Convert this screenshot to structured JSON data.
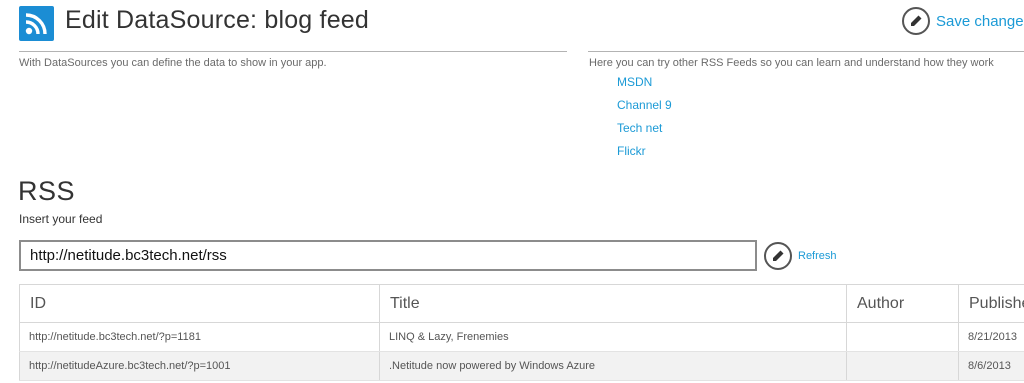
{
  "header": {
    "title": "Edit DataSource: blog feed",
    "logo_icon": "rss-icon",
    "save_label": "Save changes",
    "save_icon": "edit-pencil-icon",
    "accent_color": "#1b8dd4",
    "link_color": "#1b9ad6"
  },
  "intro": {
    "subtitle": "With DataSources you can define the data to show in your app.",
    "info_text": "Here you can try other RSS Feeds so you can learn and understand how they work"
  },
  "feed_links": [
    "MSDN",
    "Channel 9",
    "Tech net",
    "Flickr"
  ],
  "rss_section": {
    "title": "RSS",
    "input_label": "Insert your feed",
    "feed_url": "http://netitude.bc3tech.net/rss",
    "refresh_label": "Refresh",
    "refresh_icon": "edit-pencil-icon"
  },
  "table": {
    "columns": [
      "ID",
      "Title",
      "Author",
      "Published"
    ],
    "rows": [
      {
        "id": "http://netitude.bc3tech.net/?p=1181",
        "title": "LINQ & Lazy, Frenemies",
        "author": "",
        "published": "8/21/2013"
      },
      {
        "id": "http://netitudeAzure.bc3tech.net/?p=1001",
        "title": ".Netitude now powered by Windows Azure",
        "author": "",
        "published": "8/6/2013"
      }
    ]
  }
}
